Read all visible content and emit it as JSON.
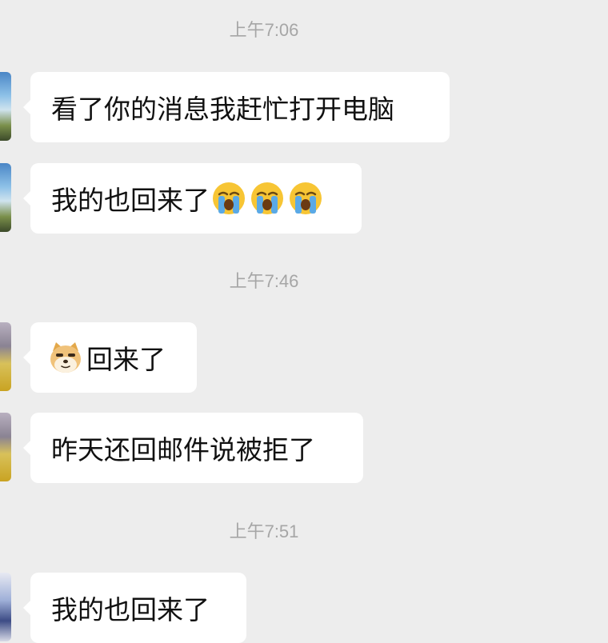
{
  "chat": {
    "timestamps": [
      "上午7:06",
      "上午7:46",
      "上午7:51"
    ],
    "messages": [
      {
        "text": "看了你的消息我赶忙打开电脑"
      },
      {
        "text": "我的也回来了",
        "emojis": [
          "loudly-crying-face-icon",
          "loudly-crying-face-icon",
          "loudly-crying-face-icon"
        ]
      },
      {
        "prefix_emoji": "doge-face-icon",
        "text": "回来了"
      },
      {
        "text": "昨天还回邮件说被拒了"
      },
      {
        "text": "我的也回来了"
      }
    ]
  },
  "colors": {
    "background": "#ededed",
    "bubble": "#ffffff",
    "timestamp_text": "#a6a6a6",
    "message_text": "#111111"
  }
}
